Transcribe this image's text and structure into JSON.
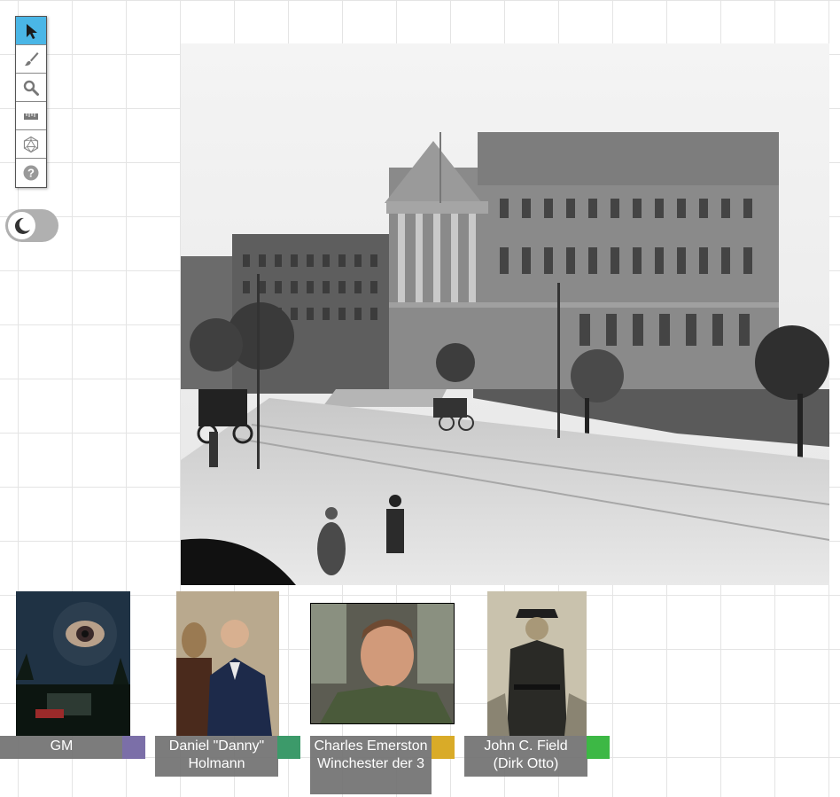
{
  "toolbar": {
    "tools": [
      {
        "name": "select",
        "icon": "pointer-icon",
        "active": true
      },
      {
        "name": "draw",
        "icon": "brush-icon",
        "active": false
      },
      {
        "name": "zoom",
        "icon": "magnifier-icon",
        "active": false
      },
      {
        "name": "measure",
        "icon": "ruler-icon",
        "active": false
      },
      {
        "name": "dice",
        "icon": "d20-icon",
        "active": false
      },
      {
        "name": "help",
        "icon": "help-icon",
        "active": false
      }
    ],
    "active_color": "#4ab6e6",
    "help_symbol": "?"
  },
  "theme_toggle": {
    "icon": "moon-icon",
    "mode": "dark"
  },
  "map": {
    "subject": "black-and-white photo of a neoclassical building on a street with horse carriages"
  },
  "players": [
    {
      "name": "GM",
      "color": "#7b6fa8"
    },
    {
      "name": "Daniel \"Danny\" Holmann",
      "color": "#3c9a6a"
    },
    {
      "name": "Charles Emerston Winchester der 3",
      "color": "#d9ab28"
    },
    {
      "name": "John C. Field (Dirk Otto)",
      "color": "#3db845"
    }
  ]
}
